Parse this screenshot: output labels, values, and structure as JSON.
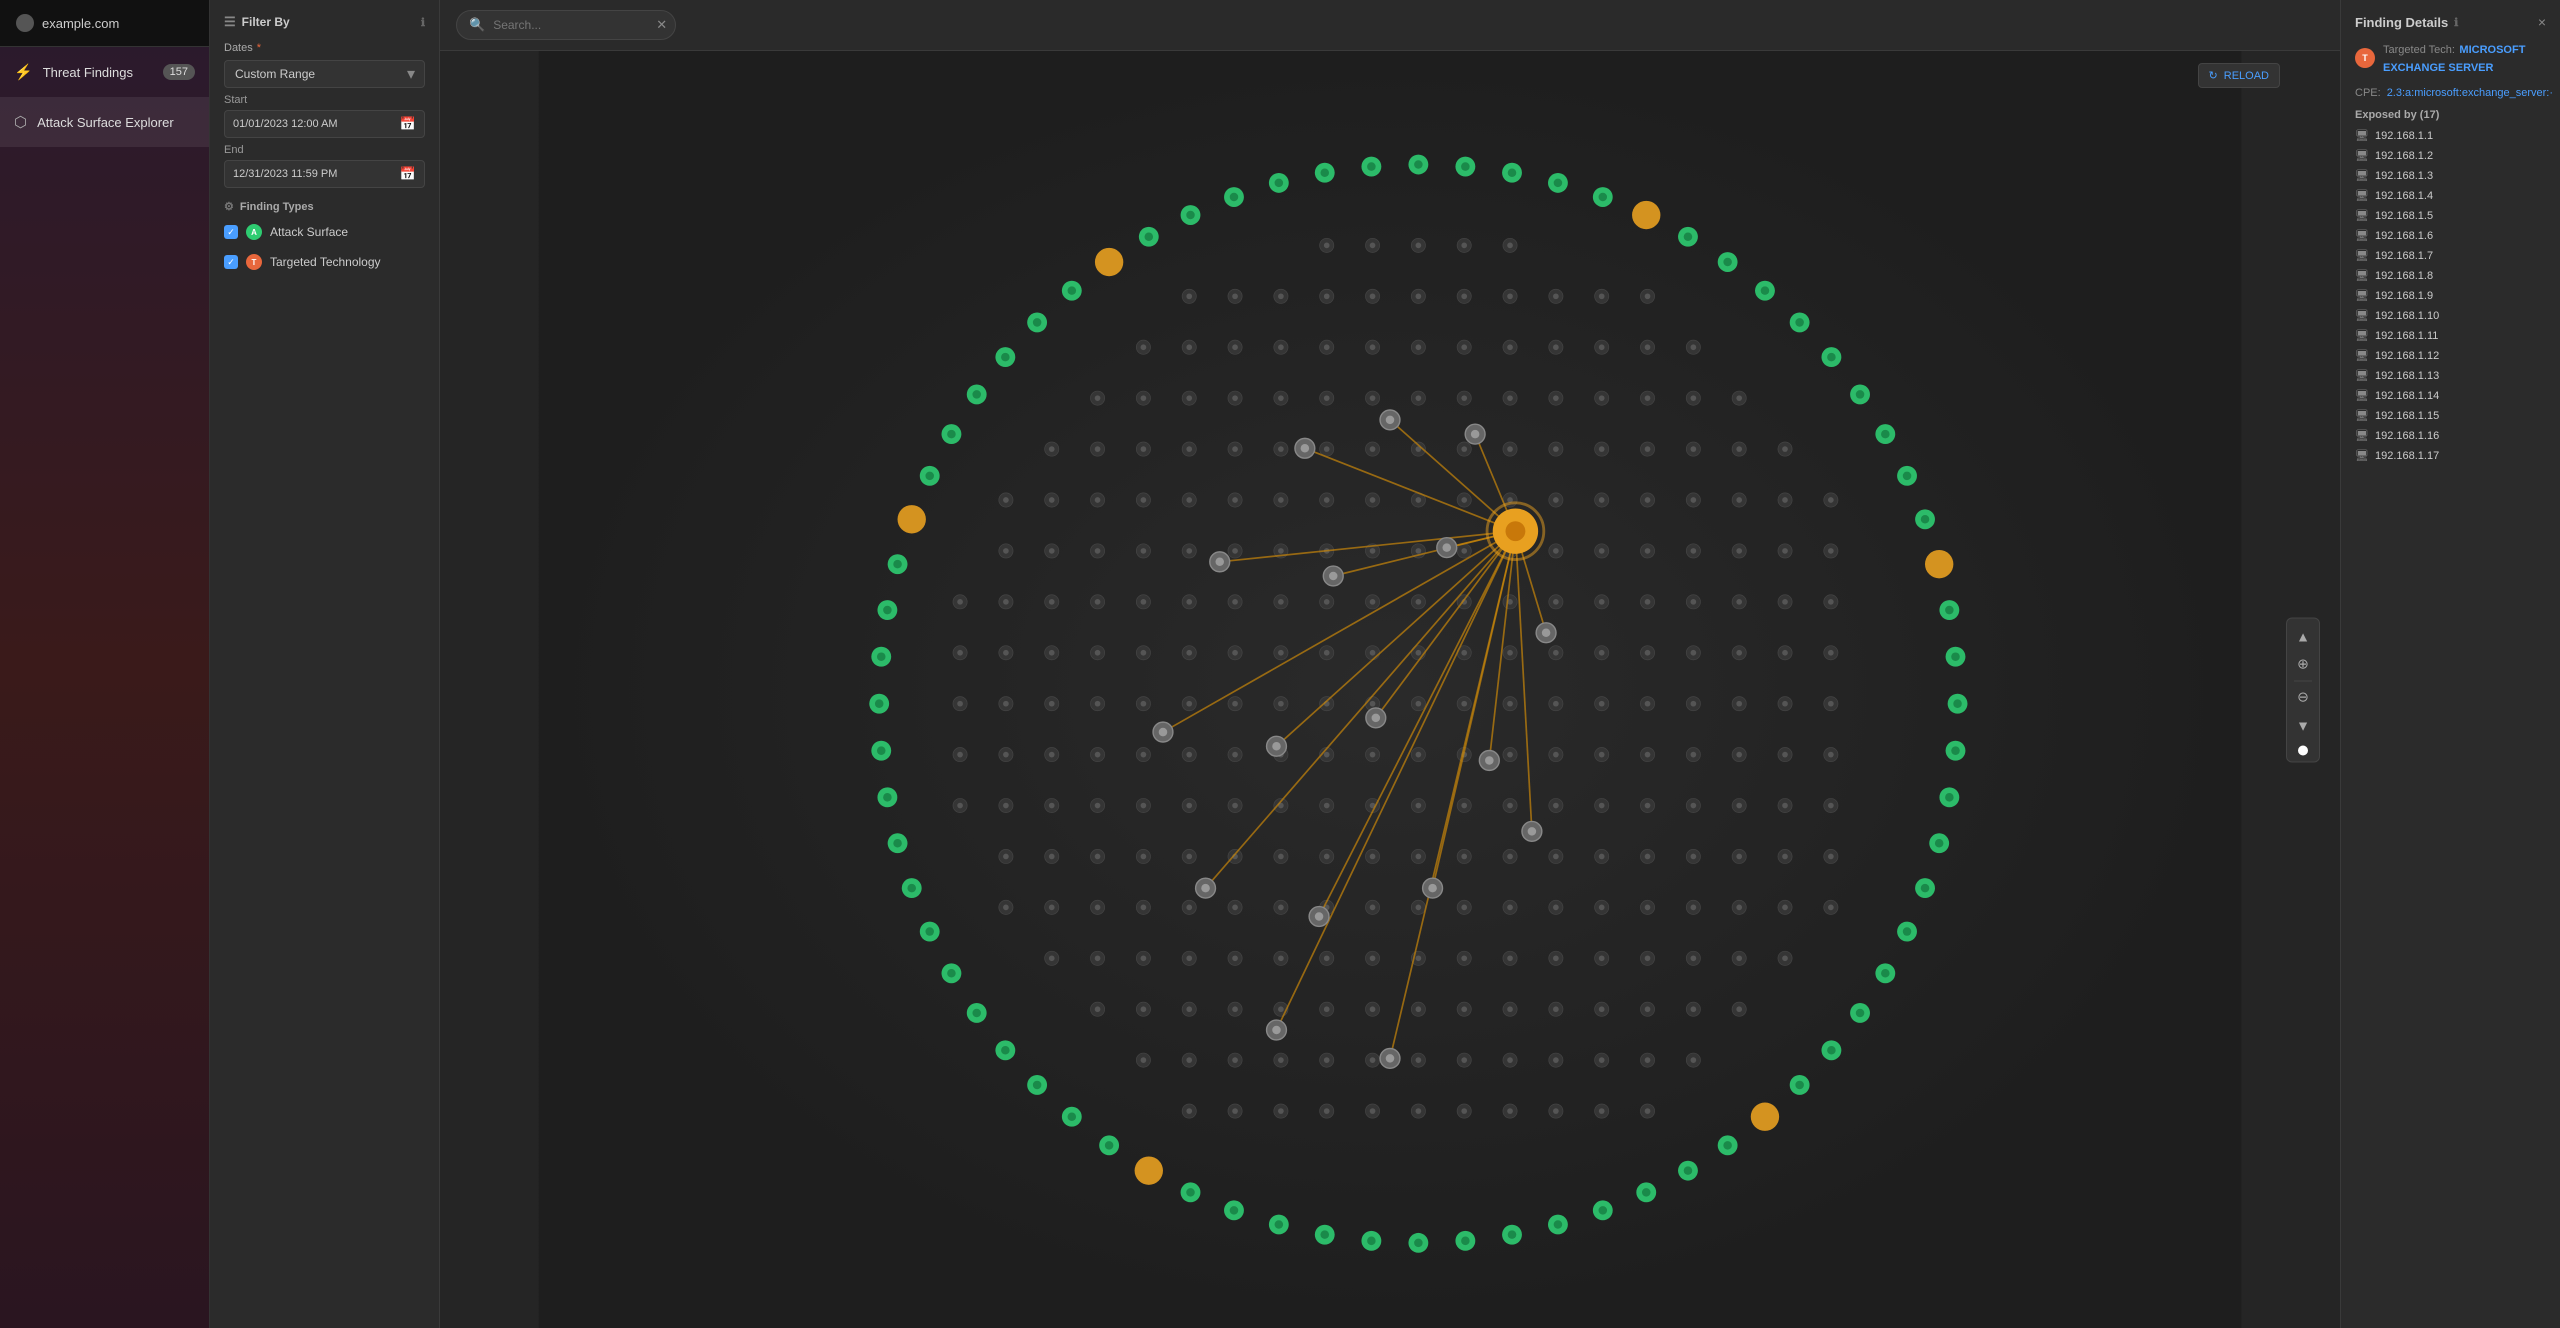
{
  "app": {
    "title": "example.com"
  },
  "sidebar": {
    "items": [
      {
        "label": "Threat Findings",
        "badge": "157",
        "icon": "⚡",
        "active": false
      },
      {
        "label": "Attack Surface Explorer",
        "badge": null,
        "icon": "⬡",
        "active": true
      }
    ]
  },
  "filter": {
    "header": "Filter By",
    "dates_label": "Dates",
    "dates_required": "*",
    "dates_option": "Custom Range",
    "start_label": "Start",
    "start_value": "01/01/2023 12:00 AM",
    "end_label": "End",
    "end_value": "12/31/2023 11:59 PM",
    "finding_types_label": "Finding Types",
    "types": [
      {
        "label": "Attack Surface",
        "color": "green"
      },
      {
        "label": "Targeted Technology",
        "color": "orange"
      }
    ]
  },
  "graph": {
    "search_placeholder": "Search...",
    "reload_label": "RELOAD"
  },
  "finding_details": {
    "title": "Finding Details",
    "close_label": "×",
    "targeted_tech_label": "Targeted Tech:",
    "targeted_tech_value": "MICROSOFT EXCHANGE SERVER",
    "cpe_label": "CPE:",
    "cpe_value": "2.3:a:microsoft:exchange_server:·",
    "exposed_label": "Exposed by (17)",
    "ip_list": [
      "192.168.1.1",
      "192.168.1.2",
      "192.168.1.3",
      "192.168.1.4",
      "192.168.1.5",
      "192.168.1.6",
      "192.168.1.7",
      "192.168.1.8",
      "192.168.1.9",
      "192.168.1.10",
      "192.168.1.11",
      "192.168.1.12",
      "192.168.1.13",
      "192.168.1.14",
      "192.168.1.15",
      "192.168.1.16",
      "192.168.1.17"
    ]
  }
}
